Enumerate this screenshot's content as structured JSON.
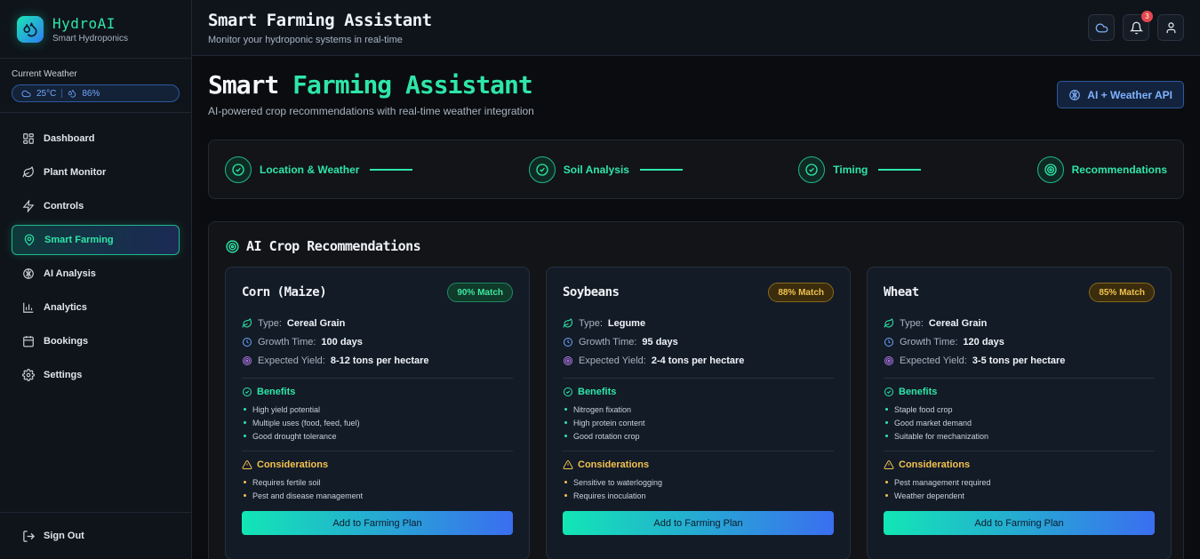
{
  "brand": {
    "name": "HydroAI",
    "subtitle": "Smart Hydroponics"
  },
  "weather": {
    "label": "Current Weather",
    "temperature": "25°C",
    "humidity": "86%"
  },
  "nav": {
    "items": [
      {
        "label": "Dashboard",
        "icon": "grid-icon"
      },
      {
        "label": "Plant Monitor",
        "icon": "leaf-icon"
      },
      {
        "label": "Controls",
        "icon": "bolt-icon"
      },
      {
        "label": "Smart Farming",
        "icon": "location-pin-icon",
        "active": true
      },
      {
        "label": "AI Analysis",
        "icon": "brain-icon"
      },
      {
        "label": "Analytics",
        "icon": "bar-chart-icon"
      },
      {
        "label": "Bookings",
        "icon": "calendar-icon"
      },
      {
        "label": "Settings",
        "icon": "gear-icon"
      }
    ],
    "signout": "Sign Out"
  },
  "topbar": {
    "title": "Smart Farming Assistant",
    "subtitle": "Monitor your hydroponic systems in real-time",
    "notification_count": "3"
  },
  "hero": {
    "title_part1": "Smart",
    "title_part2": "Farming Assistant",
    "subtitle": "AI-powered crop recommendations with real-time weather integration",
    "api_button": "AI + Weather API"
  },
  "steps": [
    {
      "label": "Location & Weather",
      "status": "done"
    },
    {
      "label": "Soil Analysis",
      "status": "done"
    },
    {
      "label": "Timing",
      "status": "done"
    },
    {
      "label": "Recommendations",
      "status": "current"
    }
  ],
  "recommendations": {
    "title": "AI Crop Recommendations",
    "labels": {
      "type": "Type:",
      "growth": "Growth Time:",
      "yield": "Expected Yield:",
      "benefits": "Benefits",
      "considerations": "Considerations",
      "add_button": "Add to Farming Plan"
    },
    "crops": [
      {
        "name": "Corn (Maize)",
        "match": "90% Match",
        "match_color": "#3ee6a0",
        "type": "Cereal Grain",
        "growth_time": "100 days",
        "yield": "8-12 tons per hectare",
        "benefits": [
          "High yield potential",
          "Multiple uses (food, feed, fuel)",
          "Good drought tolerance"
        ],
        "considerations": [
          "Requires fertile soil",
          "Pest and disease management"
        ]
      },
      {
        "name": "Soybeans",
        "match": "88% Match",
        "match_color": "#f2c14e",
        "type": "Legume",
        "growth_time": "95 days",
        "yield": "2-4 tons per hectare",
        "benefits": [
          "Nitrogen fixation",
          "High protein content",
          "Good rotation crop"
        ],
        "considerations": [
          "Sensitive to waterlogging",
          "Requires inoculation"
        ]
      },
      {
        "name": "Wheat",
        "match": "85% Match",
        "match_color": "#f2c14e",
        "type": "Cereal Grain",
        "growth_time": "120 days",
        "yield": "3-5 tons per hectare",
        "benefits": [
          "Staple food crop",
          "Good market demand",
          "Suitable for mechanization"
        ],
        "considerations": [
          "Pest management required",
          "Weather dependent"
        ]
      }
    ]
  }
}
